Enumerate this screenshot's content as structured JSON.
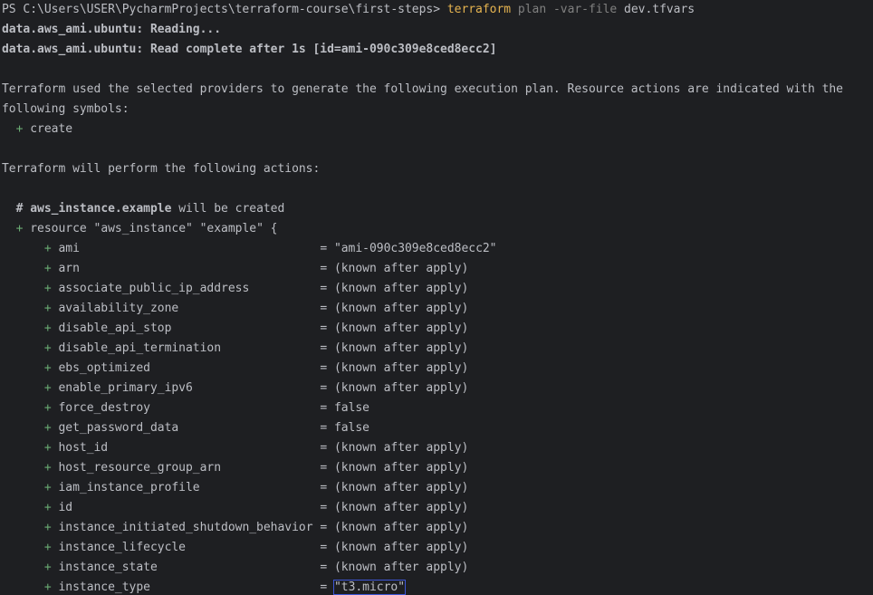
{
  "terminal": {
    "prompt": "PS C:\\Users\\USER\\PycharmProjects\\terraform-course\\first-steps> ",
    "command": "terraform",
    "subcommand": "plan",
    "flag": "-var-file",
    "flag_value": "dev.tfvars",
    "reading_line": "data.aws_ami.ubuntu: Reading...",
    "read_complete_line": "data.aws_ami.ubuntu: Read complete after 1s [id=ami-090c309e8ced8ecc2]",
    "plan_intro_1": "Terraform used the selected providers to generate the following execution plan. Resource actions are indicated with the",
    "plan_intro_2": "following symbols:",
    "symbol_plus": "+",
    "symbol_label": "create",
    "perform_line": "Terraform will perform the following actions:",
    "comment_hash": "# ",
    "resource_address": "aws_instance.example",
    "will_be_created": " will be created",
    "resource_decl": "resource \"aws_instance\" \"example\" {",
    "attributes": [
      {
        "name": "ami",
        "value": "\"ami-090c309e8ced8ecc2\""
      },
      {
        "name": "arn",
        "value": "(known after apply)"
      },
      {
        "name": "associate_public_ip_address",
        "value": "(known after apply)"
      },
      {
        "name": "availability_zone",
        "value": "(known after apply)"
      },
      {
        "name": "disable_api_stop",
        "value": "(known after apply)"
      },
      {
        "name": "disable_api_termination",
        "value": "(known after apply)"
      },
      {
        "name": "ebs_optimized",
        "value": "(known after apply)"
      },
      {
        "name": "enable_primary_ipv6",
        "value": "(known after apply)"
      },
      {
        "name": "force_destroy",
        "value": "false"
      },
      {
        "name": "get_password_data",
        "value": "false"
      },
      {
        "name": "host_id",
        "value": "(known after apply)"
      },
      {
        "name": "host_resource_group_arn",
        "value": "(known after apply)"
      },
      {
        "name": "iam_instance_profile",
        "value": "(known after apply)"
      },
      {
        "name": "id",
        "value": "(known after apply)"
      },
      {
        "name": "instance_initiated_shutdown_behavior",
        "value": "(known after apply)"
      },
      {
        "name": "instance_lifecycle",
        "value": "(known after apply)"
      },
      {
        "name": "instance_state",
        "value": "(known after apply)"
      },
      {
        "name": "instance_type",
        "value": "\"t3.micro\"",
        "highlighted": true
      }
    ]
  }
}
